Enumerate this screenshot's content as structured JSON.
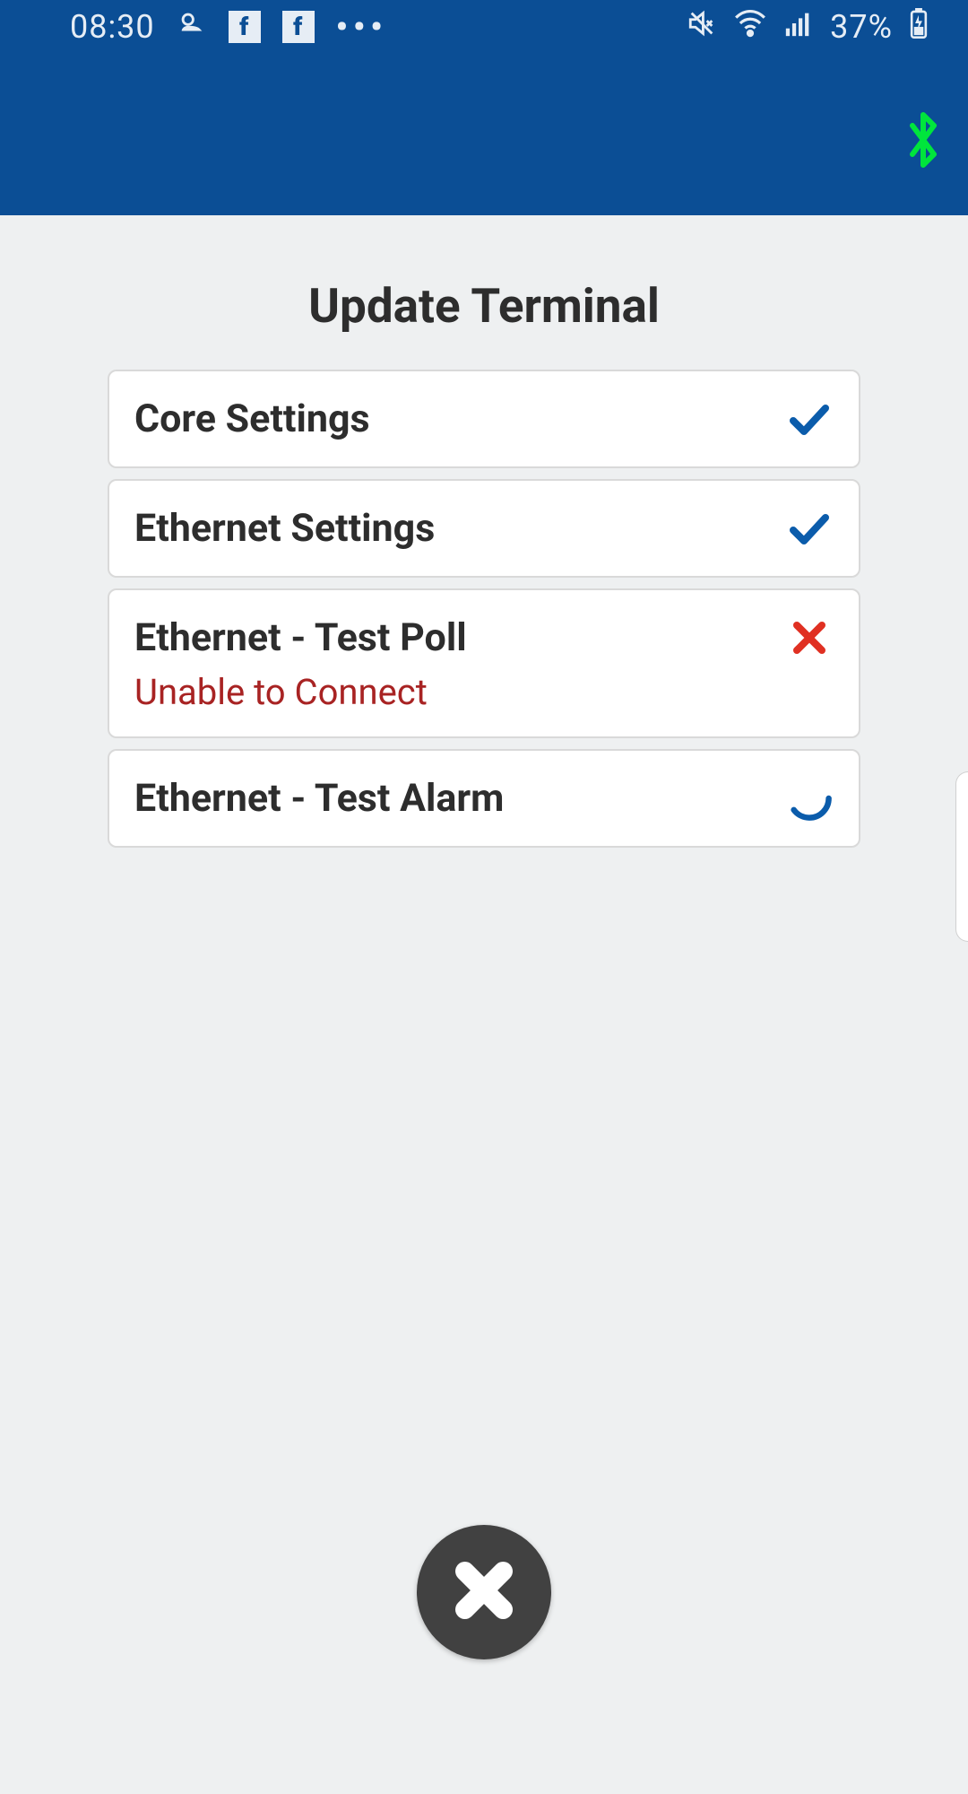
{
  "status_bar": {
    "time": "08:30",
    "battery": "37%"
  },
  "page": {
    "title": "Update Terminal"
  },
  "items": {
    "0": {
      "title": "Core Settings",
      "status": "success"
    },
    "1": {
      "title": "Ethernet Settings",
      "status": "success"
    },
    "2": {
      "title": "Ethernet - Test Poll",
      "status": "error",
      "subtitle": "Unable to Connect"
    },
    "3": {
      "title": "Ethernet - Test Alarm",
      "status": "loading"
    }
  },
  "colors": {
    "header": "#0b4e95",
    "check": "#0b5cab",
    "cross": "#e03022",
    "error_text": "#a82323",
    "bt_green": "#00e53c"
  }
}
